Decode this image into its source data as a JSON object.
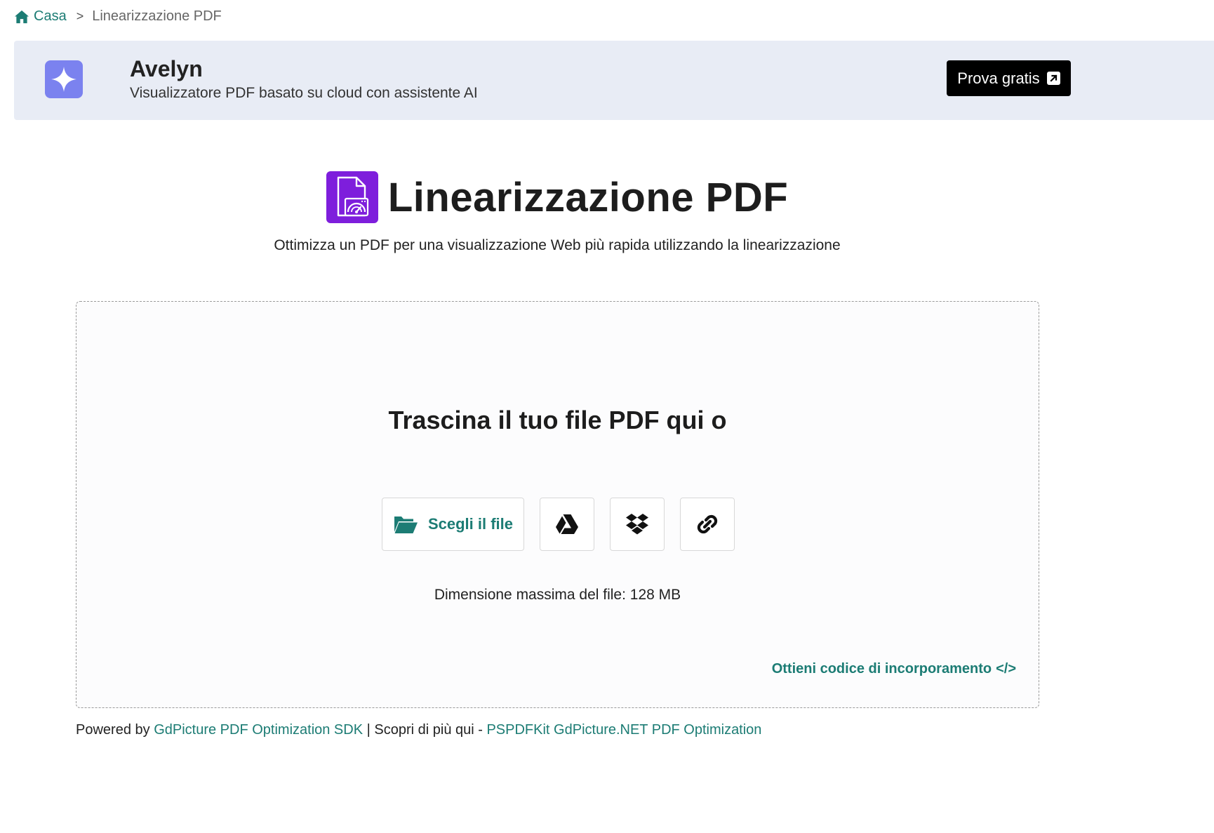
{
  "breadcrumb": {
    "home_label": "Casa",
    "separator": ">",
    "current": "Linearizzazione PDF"
  },
  "banner": {
    "brand": "Avelyn",
    "tagline": "Visualizzatore PDF basato su cloud con assistente AI",
    "cta_label": "Prova gratis"
  },
  "header": {
    "title": "Linearizzazione PDF",
    "subtitle": "Ottimizza un PDF per una visualizzazione Web più rapida utilizzando la linearizzazione"
  },
  "dropzone": {
    "heading": "Trascina il tuo file PDF qui o",
    "choose_file_label": "Scegli il file",
    "max_size": "Dimensione massima del file: 128 MB",
    "embed_label": "Ottieni codice di incorporamento",
    "embed_code_glyph": "</>"
  },
  "footer": {
    "powered_prefix": "Powered by",
    "sdk_link": "GdPicture PDF Optimization SDK",
    "middle": "| Scopri di più qui -",
    "learn_link": "PSPDFKit GdPicture.NET PDF Optimization"
  },
  "colors": {
    "accent": "#1c7c74",
    "banner_bg": "#e8ecf5",
    "logo_bg": "#7b82ef",
    "tool_icon_bg": "#7e1edc",
    "cta_bg": "#000000"
  },
  "icons": {
    "home": "home-icon",
    "logo": "sparkle-icon",
    "external": "external-link-icon",
    "tool": "pdf-speedometer-icon",
    "folder": "folder-open-icon",
    "drive": "google-drive-icon",
    "dropbox": "dropbox-icon",
    "link": "link-icon"
  }
}
